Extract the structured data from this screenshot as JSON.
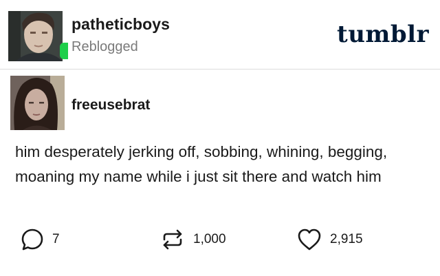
{
  "reblogger": {
    "name": "patheticboys",
    "status": "Reblogged",
    "avatar_icon": "avatar-photo-man",
    "status_dot_color": "#1ecf4a"
  },
  "brand": {
    "logo_text": "tumblr",
    "color": "#001935"
  },
  "post": {
    "author": "freeusebrat",
    "author_avatar_icon": "avatar-photo-woman",
    "text_lines": [
      "him desperately jerking off, sobbing, whining, begging,",
      "moaning my name while i just sit there and watch him"
    ]
  },
  "actions": {
    "replies": {
      "icon": "speech-bubble-icon",
      "count": "7"
    },
    "reblogs": {
      "icon": "reblog-arrows-icon",
      "count": "1,000"
    },
    "likes": {
      "icon": "heart-outline-icon",
      "count": "2,915"
    }
  }
}
